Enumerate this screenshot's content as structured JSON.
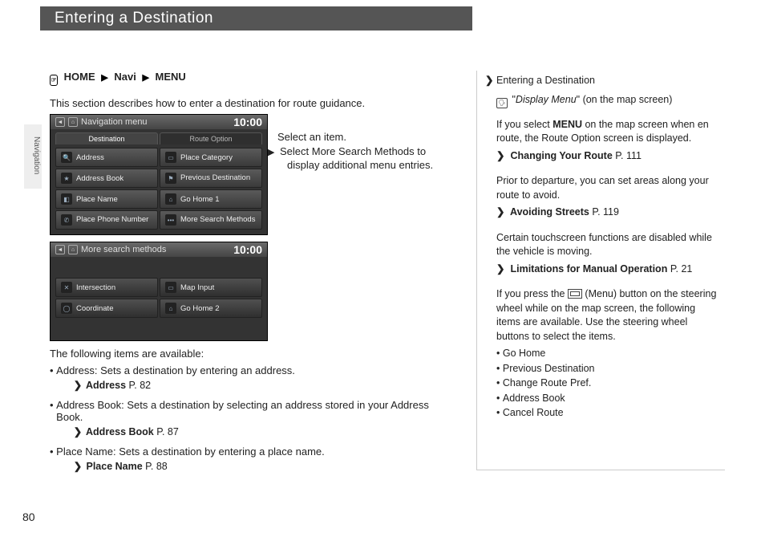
{
  "page_title": "Entering a Destination",
  "page_number": "80",
  "side_tab": "Navigation",
  "breadcrumb": {
    "i1": "HOME",
    "i2": "Navi",
    "i3": "MENU"
  },
  "intro": "This section describes how to enter a destination for route guidance.",
  "screen1": {
    "header": "Navigation menu",
    "time": "10:00",
    "tab_dest": "Destination",
    "tab_route": "Route Option",
    "btns": {
      "address": "Address",
      "place_category": "Place Category",
      "address_book": "Address Book",
      "prev_dest": "Previous Destination",
      "place_name": "Place Name",
      "go_home1": "Go Home 1",
      "place_phone": "Place Phone Number",
      "more_search": "More Search Methods"
    }
  },
  "screen2": {
    "header": "More search methods",
    "time": "10:00",
    "btns": {
      "intersection": "Intersection",
      "map_input": "Map Input",
      "coordinate": "Coordinate",
      "go_home2": "Go Home 2"
    }
  },
  "instr": {
    "line1": "Select an item.",
    "line2a": "Select ",
    "line2b": "More Search Methods",
    "line2c": " to display additional menu entries."
  },
  "avail_hdr": "The following items are available:",
  "items": {
    "address": {
      "term": "Address",
      "desc": ": Sets a destination by entering an address.",
      "xref": "Address",
      "page": "P. 82"
    },
    "abook": {
      "term": "Address Book",
      "desc": ": Sets a destination by selecting an address stored in your Address Book.",
      "xref": "Address Book",
      "page": "P. 87"
    },
    "pname": {
      "term": "Place Name",
      "desc": ": Sets a destination by entering a place name.",
      "xref": "Place Name",
      "page": "P. 88"
    }
  },
  "sidebar": {
    "title": "Entering a Destination",
    "voice_a": "\"",
    "voice_b": "Display Menu",
    "voice_c": "\" (on the map screen)",
    "p1a": "If you select ",
    "p1b": "MENU",
    "p1c": " on the map screen when en route, the Route Option screen is displayed.",
    "x1": "Changing Your Route",
    "x1p": "P. 111",
    "p2": "Prior to departure, you can set areas along your route to avoid.",
    "x2": "Avoiding Streets",
    "x2p": "P. 119",
    "p3": "Certain touchscreen functions are disabled while the vehicle is moving.",
    "x3": "Limitations for Manual Operation",
    "x3p": "P. 21",
    "p4a": "If you press the ",
    "p4b": " (Menu) button on the steering wheel while on the map screen, the following items are available. Use the steering wheel buttons to select the items.",
    "list": {
      "i1": "Go Home",
      "i2": "Previous Destination",
      "i3": "Change Route Pref.",
      "i4": "Address Book",
      "i5": "Cancel Route"
    }
  }
}
